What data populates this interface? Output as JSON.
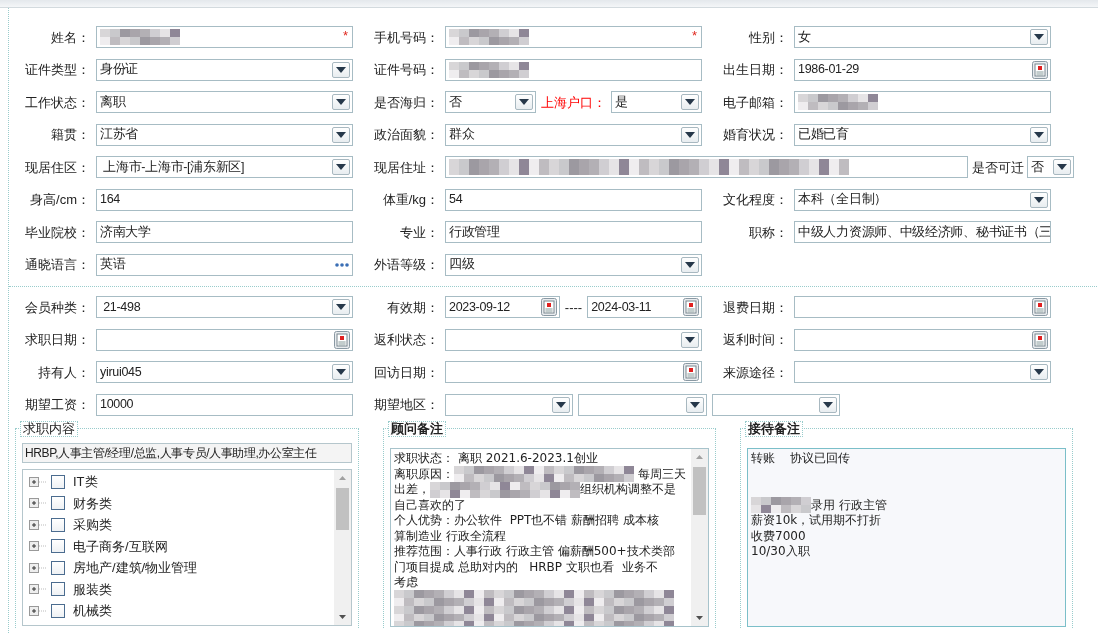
{
  "sections": [
    {
      "rows": [
        {
          "kind": "three",
          "cells": [
            {
              "label": "姓名：",
              "controls": [
                {
                  "kind": "text",
                  "redacted": true,
                  "required_mark": "*"
                }
              ]
            },
            {
              "label": "手机号码：",
              "controls": [
                {
                  "kind": "text",
                  "redacted": true,
                  "required_mark": "*"
                }
              ]
            },
            {
              "label": "性别：",
              "controls": [
                {
                  "kind": "select",
                  "value": "女"
                }
              ]
            }
          ]
        },
        {
          "kind": "three",
          "cells": [
            {
              "label": "证件类型：",
              "controls": [
                {
                  "kind": "select",
                  "value": "身份证"
                }
              ]
            },
            {
              "label": "证件号码：",
              "controls": [
                {
                  "kind": "text",
                  "redacted": true
                }
              ]
            },
            {
              "label": "出生日期：",
              "controls": [
                {
                  "kind": "date",
                  "value": "1986-01-29"
                }
              ]
            }
          ]
        },
        {
          "kind": "three",
          "cells": [
            {
              "label": "工作状态：",
              "controls": [
                {
                  "kind": "select",
                  "value": "离职"
                }
              ]
            },
            {
              "label": "是否海归：",
              "controls": [
                {
                  "kind": "select",
                  "value": "否"
                },
                {
                  "kind": "label",
                  "text": "上海户口：",
                  "emphasis": true
                },
                {
                  "kind": "select",
                  "value": "是"
                }
              ]
            },
            {
              "label": "电子邮箱：",
              "controls": [
                {
                  "kind": "text",
                  "redacted": true
                }
              ]
            }
          ]
        },
        {
          "kind": "three",
          "cells": [
            {
              "label": "籍贯：",
              "controls": [
                {
                  "kind": "select",
                  "value": "江苏省"
                }
              ]
            },
            {
              "label": "政治面貌：",
              "controls": [
                {
                  "kind": "select",
                  "value": "群众"
                }
              ]
            },
            {
              "label": "婚育状况：",
              "controls": [
                {
                  "kind": "select",
                  "value": "已婚已育"
                }
              ]
            }
          ]
        },
        {
          "kind": "wide-middle",
          "cells": [
            {
              "label": "现居住区：",
              "controls": [
                {
                  "kind": "select",
                  "value": " 上海市-上海市-[浦东新区]"
                }
              ]
            },
            {
              "label": "现居住址：",
              "controls": [
                {
                  "kind": "text",
                  "redacted": true
                }
              ]
            },
            {
              "label": "是否可迁",
              "controls": [
                {
                  "kind": "select",
                  "value": "否"
                }
              ]
            }
          ]
        },
        {
          "kind": "three",
          "cells": [
            {
              "label": "身高/cm：",
              "controls": [
                {
                  "kind": "text",
                  "value": "164"
                }
              ]
            },
            {
              "label": "体重/kg：",
              "controls": [
                {
                  "kind": "text",
                  "value": "54"
                }
              ]
            },
            {
              "label": "文化程度：",
              "controls": [
                {
                  "kind": "select",
                  "value": "本科（全日制）"
                }
              ]
            }
          ]
        },
        {
          "kind": "three",
          "cells": [
            {
              "label": "毕业院校：",
              "controls": [
                {
                  "kind": "text",
                  "value": "济南大学"
                }
              ]
            },
            {
              "label": "专业：",
              "controls": [
                {
                  "kind": "text",
                  "value": "行政管理"
                }
              ]
            },
            {
              "label": "职称：",
              "controls": [
                {
                  "kind": "text",
                  "value": "中级人力资源师、中级经济师、秘书证书（三"
                }
              ]
            }
          ]
        },
        {
          "kind": "three",
          "cells": [
            {
              "label": "通晓语言：",
              "controls": [
                {
                  "kind": "more",
                  "value": "英语"
                }
              ]
            },
            {
              "label": "外语等级：",
              "controls": [
                {
                  "kind": "select",
                  "value": "四级"
                }
              ]
            }
          ]
        }
      ]
    },
    {
      "rows": [
        {
          "kind": "three",
          "cells": [
            {
              "label": "会员种类：",
              "controls": [
                {
                  "kind": "select",
                  "value": " 21-498"
                }
              ]
            },
            {
              "label": "有效期：",
              "controls": [
                {
                  "kind": "date",
                  "value": "2023-09-12"
                },
                {
                  "kind": "label",
                  "text": "----",
                  "emphasis": false
                },
                {
                  "kind": "date",
                  "value": "2024-03-11"
                }
              ]
            },
            {
              "label": "退费日期：",
              "controls": [
                {
                  "kind": "date"
                }
              ]
            }
          ]
        },
        {
          "kind": "three",
          "cells": [
            {
              "label": "求职日期：",
              "controls": [
                {
                  "kind": "date"
                }
              ]
            },
            {
              "label": "返利状态：",
              "controls": [
                {
                  "kind": "select"
                }
              ]
            },
            {
              "label": "返利时间：",
              "controls": [
                {
                  "kind": "date"
                }
              ]
            }
          ]
        },
        {
          "kind": "three",
          "cells": [
            {
              "label": "持有人：",
              "controls": [
                {
                  "kind": "select",
                  "value": "yirui045"
                }
              ]
            },
            {
              "label": "回访日期：",
              "controls": [
                {
                  "kind": "date"
                }
              ]
            },
            {
              "label": "来源途径：",
              "controls": [
                {
                  "kind": "select"
                }
              ]
            }
          ]
        },
        {
          "kind": "wide-middle",
          "cells": [
            {
              "label": "期望工资：",
              "controls": [
                {
                  "kind": "text",
                  "value": "10000"
                }
              ]
            },
            {
              "label": "期望地区：",
              "controls": [
                {
                  "kind": "select"
                },
                {
                  "kind": "select"
                },
                {
                  "kind": "select"
                }
              ]
            }
          ]
        }
      ]
    }
  ],
  "job_content": {
    "legend": "求职内容",
    "summary": "HRBP,人事主管/经理/总监,人事专员/人事助理,办公室主任",
    "tree": [
      {
        "label": "IT类",
        "checked": false,
        "expanded": false
      },
      {
        "label": "财务类",
        "checked": false,
        "expanded": false
      },
      {
        "label": "采购类",
        "checked": false,
        "expanded": false
      },
      {
        "label": "电子商务/互联网",
        "checked": false,
        "expanded": false
      },
      {
        "label": "房地产/建筑/物业管理",
        "checked": false,
        "expanded": false
      },
      {
        "label": "服装类",
        "checked": false,
        "expanded": false
      },
      {
        "label": "机械类",
        "checked": false,
        "expanded": false
      }
    ]
  },
  "advisor_notes": {
    "legend": "顾问备注",
    "lines": [
      {
        "segments": [
          {
            "kind": "text",
            "text": "求职状态： 离职 2021.6-2023.1创业"
          }
        ]
      },
      {
        "segments": [
          {
            "kind": "text",
            "text": "离职原因："
          },
          {
            "kind": "redacted"
          },
          {
            "kind": "text",
            "text": " 每周三天"
          }
        ]
      },
      {
        "segments": [
          {
            "kind": "text",
            "text": "出差，"
          },
          {
            "kind": "redacted"
          },
          {
            "kind": "text",
            "text": "组织机构调整不是"
          }
        ]
      },
      {
        "segments": [
          {
            "kind": "text",
            "text": "自己喜欢的了"
          }
        ]
      },
      {
        "segments": [
          {
            "kind": "text",
            "text": "个人优势：办公软件  PPT也不错 薪酬招聘 成本核"
          }
        ]
      },
      {
        "segments": [
          {
            "kind": "text",
            "text": "算制造业 行政全流程"
          }
        ]
      },
      {
        "segments": [
          {
            "kind": "text",
            "text": "推荐范围：人事行政 行政主管 偏薪酬500+技术类部"
          }
        ]
      },
      {
        "segments": [
          {
            "kind": "text",
            "text": "门项目提成 总助对内的   HRBP 文职也看  业务不"
          }
        ]
      },
      {
        "segments": [
          {
            "kind": "text",
            "text": "考虑"
          }
        ]
      },
      {
        "segments": [
          {
            "kind": "redacted"
          }
        ]
      },
      {
        "segments": [
          {
            "kind": "redacted"
          }
        ]
      },
      {
        "segments": [
          {
            "kind": "redacted"
          }
        ]
      }
    ]
  },
  "reception_notes": {
    "legend": "接待备注",
    "lines": [
      {
        "segments": [
          {
            "kind": "text",
            "text": "转账    协议已回传"
          }
        ]
      },
      {
        "kind": "blank"
      },
      {
        "kind": "blank"
      },
      {
        "segments": [
          {
            "kind": "redacted"
          },
          {
            "kind": "text",
            "text": "录用 行政主管"
          }
        ]
      },
      {
        "segments": [
          {
            "kind": "text",
            "text": "薪资10k，试用期不打折"
          }
        ]
      },
      {
        "segments": [
          {
            "kind": "text",
            "text": "收费7000"
          }
        ]
      },
      {
        "segments": [
          {
            "kind": "text",
            "text": "10/30入职"
          }
        ]
      }
    ]
  }
}
